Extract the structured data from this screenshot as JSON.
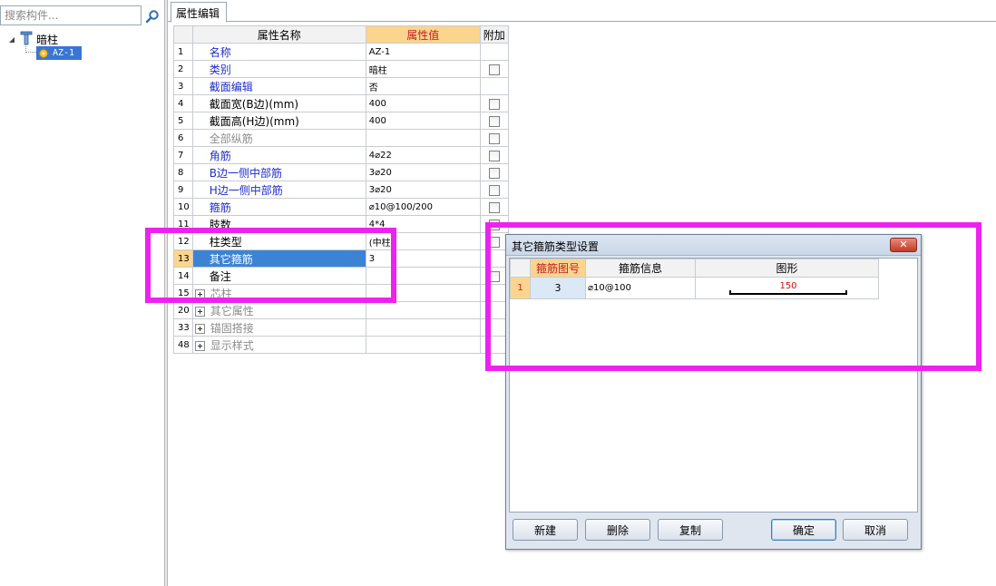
{
  "search": {
    "placeholder": "搜索构件..."
  },
  "tree": {
    "root_label": "暗柱",
    "child_label": "AZ-1"
  },
  "tab": {
    "label": "属性编辑"
  },
  "grid": {
    "headers": {
      "name": "属性名称",
      "value": "属性值",
      "extra": "附加"
    },
    "rows": [
      {
        "num": "1",
        "name": "名称",
        "value": "AZ-1",
        "checkbox": false
      },
      {
        "num": "2",
        "name": "类别",
        "value": "暗柱",
        "checkbox": true
      },
      {
        "num": "3",
        "name": "截面编辑",
        "value": "否",
        "checkbox": false
      },
      {
        "num": "4",
        "name": "截面宽(B边)(mm)",
        "value": "400",
        "checkbox": true
      },
      {
        "num": "5",
        "name": "截面高(H边)(mm)",
        "value": "400",
        "checkbox": true
      },
      {
        "num": "6",
        "name": "全部纵筋",
        "value": "",
        "checkbox": true
      },
      {
        "num": "7",
        "name": "角筋",
        "value": "4⌀22",
        "checkbox": true
      },
      {
        "num": "8",
        "name": "B边一侧中部筋",
        "value": "3⌀20",
        "checkbox": true
      },
      {
        "num": "9",
        "name": "H边一侧中部筋",
        "value": "3⌀20",
        "checkbox": true
      },
      {
        "num": "10",
        "name": "箍筋",
        "value": "⌀10@100/200",
        "checkbox": true
      },
      {
        "num": "11",
        "name": "肢数",
        "value": "4*4",
        "checkbox": true
      },
      {
        "num": "12",
        "name": "柱类型",
        "value": "(中柱)",
        "checkbox": true
      },
      {
        "num": "13",
        "name": "其它箍筋",
        "value": "3",
        "checkbox": false
      },
      {
        "num": "14",
        "name": "备注",
        "value": "",
        "checkbox": true
      },
      {
        "num": "15",
        "name": "芯柱",
        "value": "",
        "checkbox": false
      },
      {
        "num": "20",
        "name": "其它属性",
        "value": "",
        "checkbox": false
      },
      {
        "num": "33",
        "name": "锚固搭接",
        "value": "",
        "checkbox": false
      },
      {
        "num": "48",
        "name": "显示样式",
        "value": "",
        "checkbox": false
      }
    ]
  },
  "dialog": {
    "title": "其它箍筋类型设置",
    "close_label": "✕",
    "headers": {
      "fig_no": "箍筋图号",
      "info": "箍筋信息",
      "shape": "图形"
    },
    "row": {
      "num": "1",
      "fig_no": "3",
      "info": "⌀10@100",
      "shape_value": "150"
    },
    "buttons": {
      "new": "新建",
      "delete": "删除",
      "copy": "复制",
      "ok": "确定",
      "cancel": "取消"
    }
  },
  "colors": {
    "highlight": "#ee22ee",
    "selection": "#3c83d4",
    "header_accent": "#fbd48e",
    "blue_text": "#1e2ec8",
    "gray_text": "#8b8b8b"
  }
}
